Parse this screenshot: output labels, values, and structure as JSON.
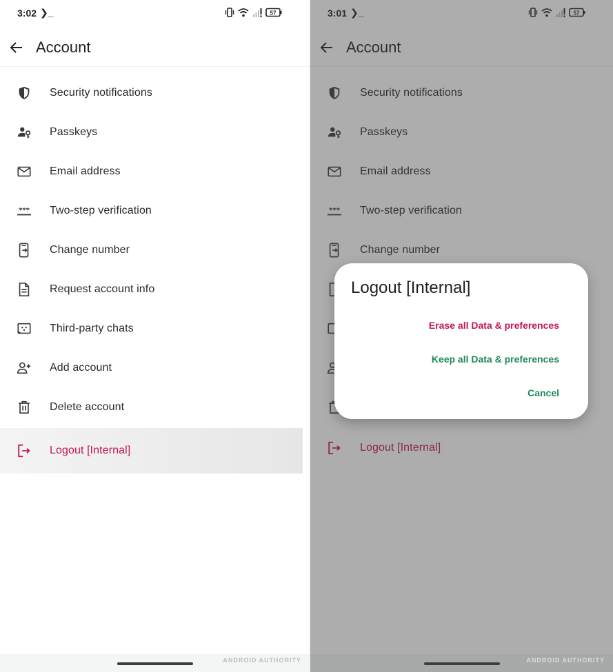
{
  "left": {
    "status": {
      "time": "3:02",
      "battery": "57"
    },
    "title": "Account",
    "items": [
      {
        "label": "Security notifications",
        "icon": "shield-icon"
      },
      {
        "label": "Passkeys",
        "icon": "person-key-icon"
      },
      {
        "label": "Email address",
        "icon": "mail-icon"
      },
      {
        "label": "Two-step verification",
        "icon": "password-dots-icon"
      },
      {
        "label": "Change number",
        "icon": "phone-swap-icon"
      },
      {
        "label": "Request account info",
        "icon": "document-icon"
      },
      {
        "label": "Third-party chats",
        "icon": "chat-box-icon"
      },
      {
        "label": "Add account",
        "icon": "person-add-icon"
      },
      {
        "label": "Delete account",
        "icon": "trash-icon"
      },
      {
        "label": "Logout [Internal]",
        "icon": "logout-icon"
      }
    ],
    "watermark": "ANDROID AUTHORITY"
  },
  "right": {
    "status": {
      "time": "3:01",
      "battery": "57"
    },
    "title": "Account",
    "items": [
      {
        "label": "Security notifications",
        "icon": "shield-icon"
      },
      {
        "label": "Passkeys",
        "icon": "person-key-icon"
      },
      {
        "label": "Email address",
        "icon": "mail-icon"
      },
      {
        "label": "Two-step verification",
        "icon": "password-dots-icon"
      },
      {
        "label": "Change number",
        "icon": "phone-swap-icon"
      },
      {
        "label": "Logout [Internal]",
        "icon": "logout-icon"
      }
    ],
    "dialog": {
      "title": "Logout [Internal]",
      "erase_label": "Erase all Data & preferences",
      "keep_label": "Keep all Data & preferences",
      "cancel_label": "Cancel"
    },
    "watermark": "ANDROID AUTHORITY"
  },
  "colors": {
    "danger": "#c2174e",
    "positive": "#1f8a5b",
    "scrim": "#404040"
  }
}
